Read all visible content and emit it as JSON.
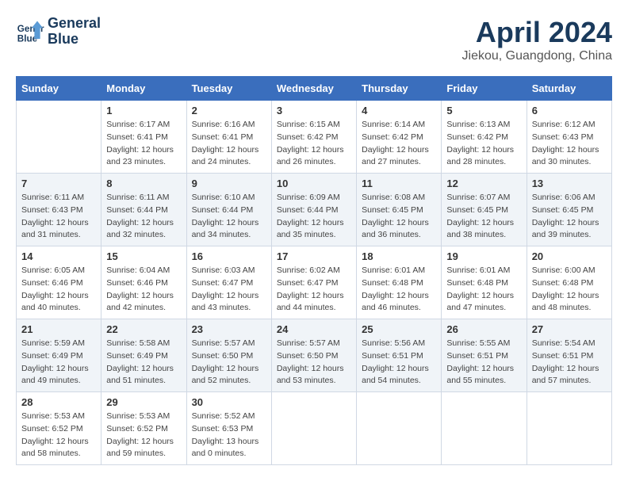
{
  "header": {
    "logo_line1": "General",
    "logo_line2": "Blue",
    "month": "April 2024",
    "location": "Jiekou, Guangdong, China"
  },
  "weekdays": [
    "Sunday",
    "Monday",
    "Tuesday",
    "Wednesday",
    "Thursday",
    "Friday",
    "Saturday"
  ],
  "weeks": [
    [
      null,
      {
        "day": "1",
        "sunrise": "6:17 AM",
        "sunset": "6:41 PM",
        "daylight": "12 hours and 23 minutes."
      },
      {
        "day": "2",
        "sunrise": "6:16 AM",
        "sunset": "6:41 PM",
        "daylight": "12 hours and 24 minutes."
      },
      {
        "day": "3",
        "sunrise": "6:15 AM",
        "sunset": "6:42 PM",
        "daylight": "12 hours and 26 minutes."
      },
      {
        "day": "4",
        "sunrise": "6:14 AM",
        "sunset": "6:42 PM",
        "daylight": "12 hours and 27 minutes."
      },
      {
        "day": "5",
        "sunrise": "6:13 AM",
        "sunset": "6:42 PM",
        "daylight": "12 hours and 28 minutes."
      },
      {
        "day": "6",
        "sunrise": "6:12 AM",
        "sunset": "6:43 PM",
        "daylight": "12 hours and 30 minutes."
      }
    ],
    [
      {
        "day": "7",
        "sunrise": "6:11 AM",
        "sunset": "6:43 PM",
        "daylight": "12 hours and 31 minutes."
      },
      {
        "day": "8",
        "sunrise": "6:11 AM",
        "sunset": "6:44 PM",
        "daylight": "12 hours and 32 minutes."
      },
      {
        "day": "9",
        "sunrise": "6:10 AM",
        "sunset": "6:44 PM",
        "daylight": "12 hours and 34 minutes."
      },
      {
        "day": "10",
        "sunrise": "6:09 AM",
        "sunset": "6:44 PM",
        "daylight": "12 hours and 35 minutes."
      },
      {
        "day": "11",
        "sunrise": "6:08 AM",
        "sunset": "6:45 PM",
        "daylight": "12 hours and 36 minutes."
      },
      {
        "day": "12",
        "sunrise": "6:07 AM",
        "sunset": "6:45 PM",
        "daylight": "12 hours and 38 minutes."
      },
      {
        "day": "13",
        "sunrise": "6:06 AM",
        "sunset": "6:45 PM",
        "daylight": "12 hours and 39 minutes."
      }
    ],
    [
      {
        "day": "14",
        "sunrise": "6:05 AM",
        "sunset": "6:46 PM",
        "daylight": "12 hours and 40 minutes."
      },
      {
        "day": "15",
        "sunrise": "6:04 AM",
        "sunset": "6:46 PM",
        "daylight": "12 hours and 42 minutes."
      },
      {
        "day": "16",
        "sunrise": "6:03 AM",
        "sunset": "6:47 PM",
        "daylight": "12 hours and 43 minutes."
      },
      {
        "day": "17",
        "sunrise": "6:02 AM",
        "sunset": "6:47 PM",
        "daylight": "12 hours and 44 minutes."
      },
      {
        "day": "18",
        "sunrise": "6:01 AM",
        "sunset": "6:48 PM",
        "daylight": "12 hours and 46 minutes."
      },
      {
        "day": "19",
        "sunrise": "6:01 AM",
        "sunset": "6:48 PM",
        "daylight": "12 hours and 47 minutes."
      },
      {
        "day": "20",
        "sunrise": "6:00 AM",
        "sunset": "6:48 PM",
        "daylight": "12 hours and 48 minutes."
      }
    ],
    [
      {
        "day": "21",
        "sunrise": "5:59 AM",
        "sunset": "6:49 PM",
        "daylight": "12 hours and 49 minutes."
      },
      {
        "day": "22",
        "sunrise": "5:58 AM",
        "sunset": "6:49 PM",
        "daylight": "12 hours and 51 minutes."
      },
      {
        "day": "23",
        "sunrise": "5:57 AM",
        "sunset": "6:50 PM",
        "daylight": "12 hours and 52 minutes."
      },
      {
        "day": "24",
        "sunrise": "5:57 AM",
        "sunset": "6:50 PM",
        "daylight": "12 hours and 53 minutes."
      },
      {
        "day": "25",
        "sunrise": "5:56 AM",
        "sunset": "6:51 PM",
        "daylight": "12 hours and 54 minutes."
      },
      {
        "day": "26",
        "sunrise": "5:55 AM",
        "sunset": "6:51 PM",
        "daylight": "12 hours and 55 minutes."
      },
      {
        "day": "27",
        "sunrise": "5:54 AM",
        "sunset": "6:51 PM",
        "daylight": "12 hours and 57 minutes."
      }
    ],
    [
      {
        "day": "28",
        "sunrise": "5:53 AM",
        "sunset": "6:52 PM",
        "daylight": "12 hours and 58 minutes."
      },
      {
        "day": "29",
        "sunrise": "5:53 AM",
        "sunset": "6:52 PM",
        "daylight": "12 hours and 59 minutes."
      },
      {
        "day": "30",
        "sunrise": "5:52 AM",
        "sunset": "6:53 PM",
        "daylight": "13 hours and 0 minutes."
      },
      null,
      null,
      null,
      null
    ]
  ]
}
